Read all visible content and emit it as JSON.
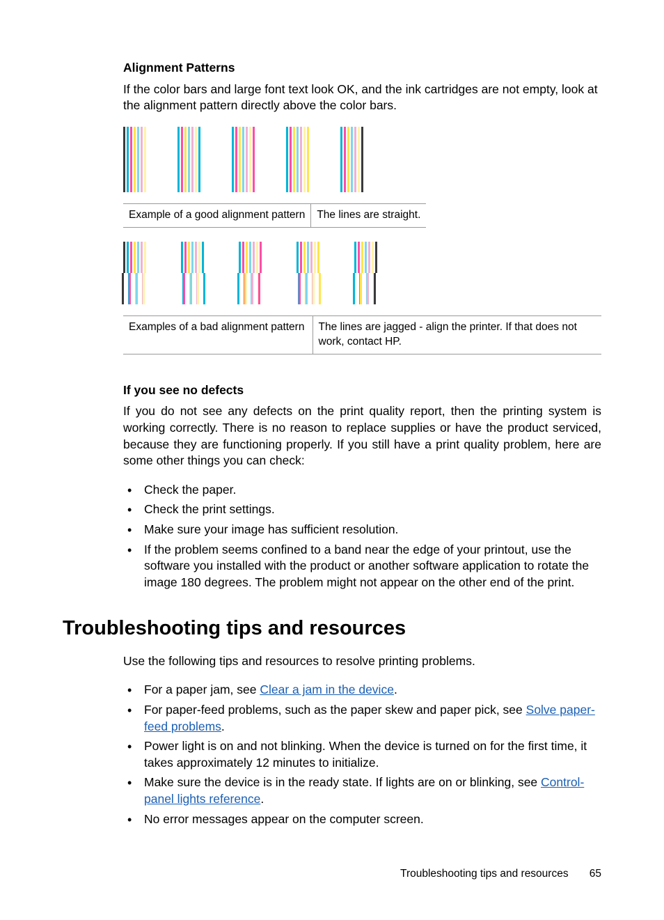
{
  "section1": {
    "heading": "Alignment Patterns",
    "intro": "If the color bars and large font text look OK, and the ink cartridges are not empty, look at the alignment pattern directly above the color bars."
  },
  "good_pattern": {
    "clusters": [
      [
        "#3a3a3a",
        "#00b5d8",
        "#ff4da6",
        "#ffe44d",
        "#7fd6e8",
        "#f2b0d4",
        "#fff3a8"
      ],
      [
        "#00b5d8",
        "#ff4da6",
        "#ffe44d",
        "#7fd6e8",
        "#f2b0d4",
        "#fff3a8",
        "#00b5d8"
      ],
      [
        "#00b5d8",
        "#ff4da6",
        "#ffe44d",
        "#7fd6e8",
        "#f2b0d4",
        "#fff3a8",
        "#ff4da6"
      ],
      [
        "#00b5d8",
        "#ff4da6",
        "#ffe44d",
        "#7fd6e8",
        "#f2b0d4",
        "#fff3a8",
        "#ffe44d"
      ],
      [
        "#00b5d8",
        "#ff4da6",
        "#ffe44d",
        "#7fd6e8",
        "#f2b0d4",
        "#fff3a8",
        "#3a3a3a"
      ]
    ],
    "caption_left": "Example of a good alignment pattern",
    "caption_right": "The lines are straight."
  },
  "bad_pattern": {
    "clusters": [
      [
        "#3a3a3a",
        "#00b5d8",
        "#ff4da6",
        "#ffe44d",
        "#7fd6e8",
        "#f2b0d4",
        "#fff3a8"
      ],
      [
        "#00b5d8",
        "#ff4da6",
        "#ffe44d",
        "#7fd6e8",
        "#f2b0d4",
        "#fff3a8",
        "#00b5d8"
      ],
      [
        "#00b5d8",
        "#ff4da6",
        "#ffe44d",
        "#7fd6e8",
        "#f2b0d4",
        "#fff3a8",
        "#ff4da6"
      ],
      [
        "#00b5d8",
        "#ff4da6",
        "#ffe44d",
        "#7fd6e8",
        "#f2b0d4",
        "#fff3a8",
        "#ffe44d"
      ],
      [
        "#00b5d8",
        "#ff4da6",
        "#ffe44d",
        "#7fd6e8",
        "#f2b0d4",
        "#fff3a8",
        "#3a3a3a"
      ]
    ],
    "caption_left": "Examples of a bad alignment pattern",
    "caption_right": "The lines are jagged - align the printer. If that does not work, contact HP."
  },
  "section2": {
    "heading": "If you see no defects",
    "intro": "If you do not see any defects on the print quality report, then the printing system is working correctly. There is no reason to replace supplies or have the product serviced, because they are functioning properly. If you still have a print quality problem, here are some other things you can check:",
    "bullets": [
      "Check the paper.",
      "Check the print settings.",
      "Make sure your image has sufficient resolution.",
      "If the problem seems confined to a band near the edge of your printout, use the software you installed with the product or another software application to rotate the image 180 degrees. The problem might not appear on the other end of the print."
    ]
  },
  "section3": {
    "heading": "Troubleshooting tips and resources",
    "intro": "Use the following tips and resources to resolve printing problems.",
    "items": [
      {
        "prefix": "For a paper jam, see ",
        "link": "Clear a jam in the device",
        "suffix": "."
      },
      {
        "prefix": "For paper-feed problems, such as the paper skew and paper pick, see ",
        "link": "Solve paper-feed problems",
        "suffix": "."
      },
      {
        "text": "Power light is on and not blinking. When the device is turned on for the first time, it takes approximately 12 minutes to initialize."
      },
      {
        "prefix": "Make sure the device is in the ready state. If lights are on or blinking, see ",
        "link": "Control-panel lights reference",
        "suffix": "."
      },
      {
        "text": "No error messages appear on the computer screen."
      }
    ]
  },
  "footer": {
    "title": "Troubleshooting tips and resources",
    "page": "65"
  }
}
